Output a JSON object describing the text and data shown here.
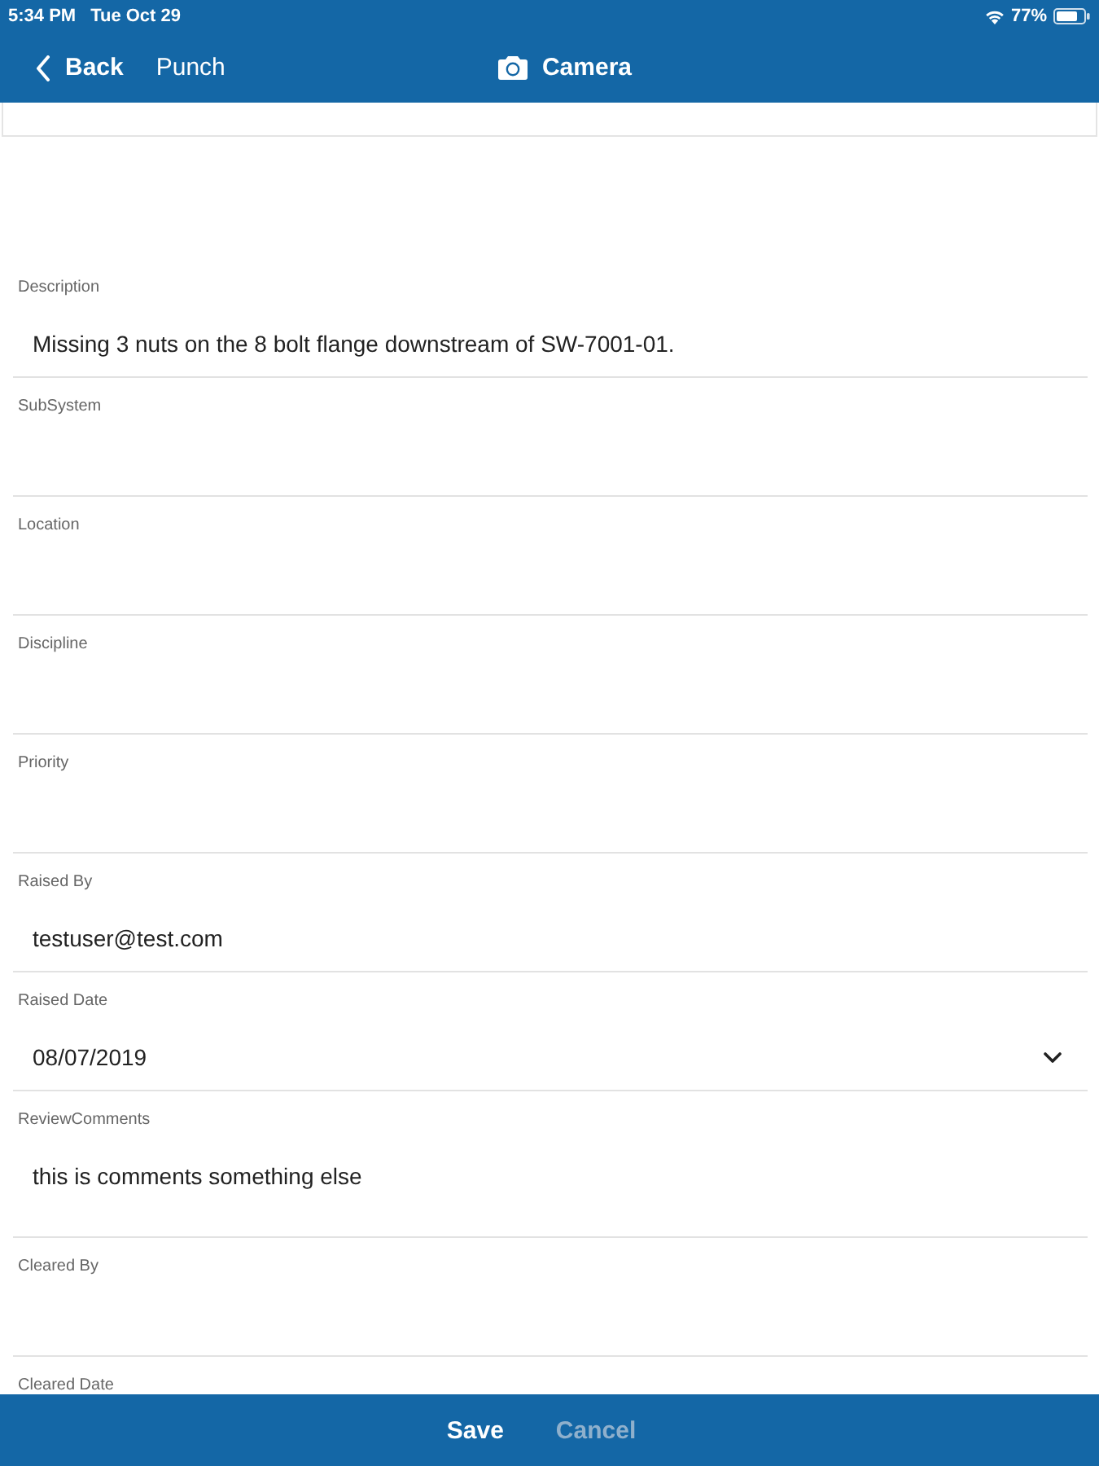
{
  "status_bar": {
    "time": "5:34 PM",
    "date": "Tue Oct 29",
    "battery": "77%"
  },
  "nav_bar": {
    "back": "Back",
    "link": "Punch",
    "title": "Camera"
  },
  "fields": [
    {
      "label": "Description",
      "kind": "text",
      "value": "Missing 3 nuts on the 8 bolt flange downstream of SW-7001-01."
    },
    {
      "label": "SubSystem",
      "kind": "text"
    },
    {
      "label": "Location",
      "kind": "text"
    },
    {
      "label": "Discipline",
      "kind": "text"
    },
    {
      "label": "Priority",
      "kind": "text"
    },
    {
      "label": "Raised By",
      "kind": "text",
      "value": "testuser@test.com"
    },
    {
      "label": "Raised Date",
      "kind": "date",
      "value": "08/07/2019"
    },
    {
      "label": "ReviewComments",
      "kind": "textarea",
      "value": "this is comments something else"
    },
    {
      "label": "Cleared By",
      "kind": "text"
    },
    {
      "label": "Cleared Date",
      "kind": "text"
    }
  ],
  "footer": {
    "buttons": [
      {
        "label": "Save",
        "disabled": false
      },
      {
        "label": "Cancel",
        "disabled": true
      }
    ]
  }
}
